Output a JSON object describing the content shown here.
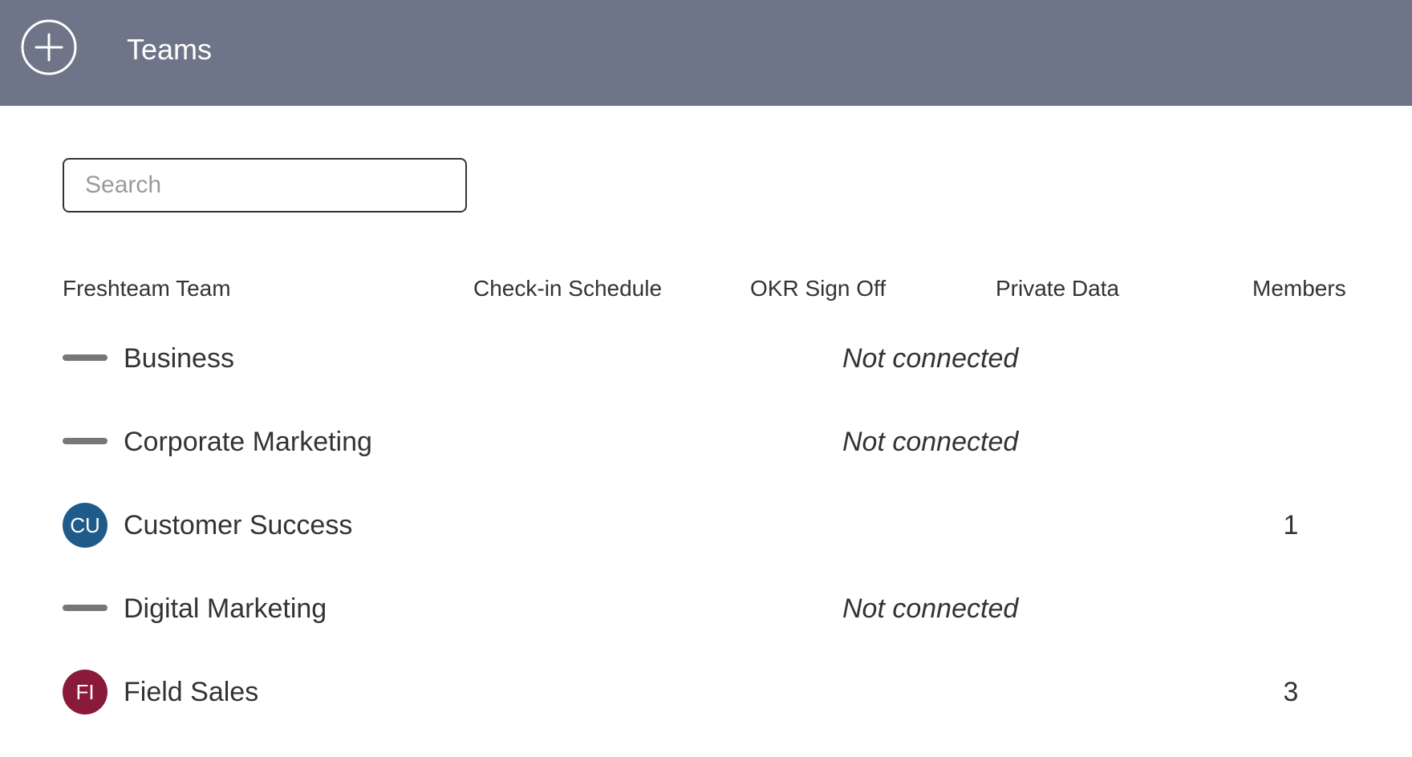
{
  "header": {
    "title": "Teams",
    "add_icon": "plus-circle-icon",
    "background_color": "#6f7589"
  },
  "search": {
    "placeholder": "Search",
    "value": ""
  },
  "table": {
    "columns": [
      "Freshteam Team",
      "Check-in Schedule",
      "OKR Sign Off",
      "Private Data",
      "Members"
    ],
    "rows": [
      {
        "name": "Business",
        "avatar": null,
        "avatar_color": null,
        "status": "Not connected",
        "members": ""
      },
      {
        "name": "Corporate Marketing",
        "avatar": null,
        "avatar_color": null,
        "status": "Not connected",
        "members": ""
      },
      {
        "name": "Customer Success",
        "avatar": "CU",
        "avatar_color": "#1f5b8a",
        "status": "",
        "members": "1"
      },
      {
        "name": "Digital Marketing",
        "avatar": null,
        "avatar_color": null,
        "status": "Not connected",
        "members": ""
      },
      {
        "name": "Field Sales",
        "avatar": "FI",
        "avatar_color": "#8a1a3a",
        "status": "",
        "members": "3"
      }
    ]
  }
}
